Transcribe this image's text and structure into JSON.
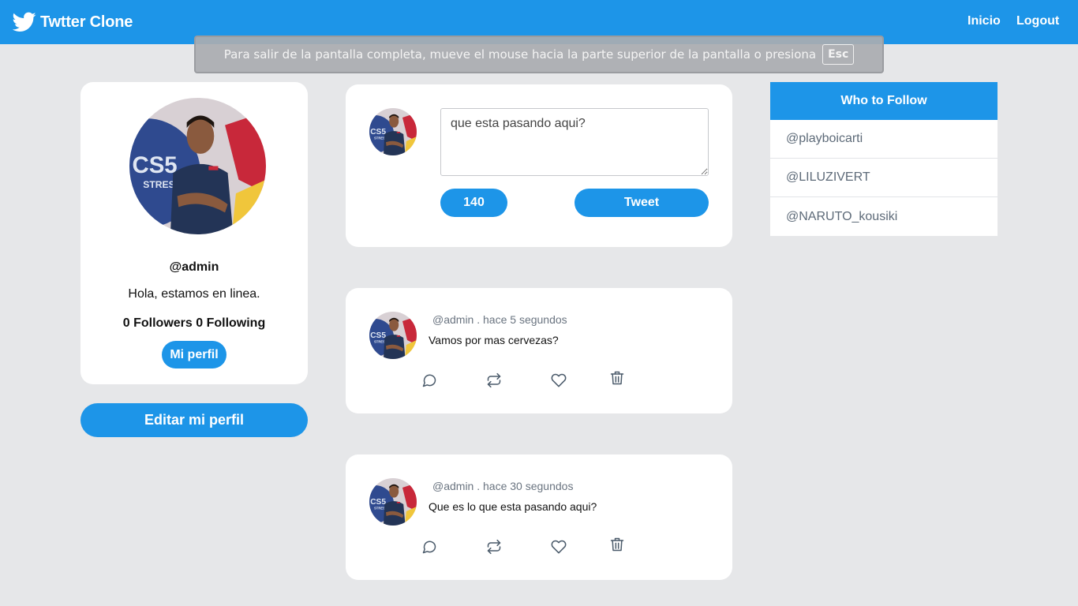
{
  "navbar": {
    "brand": "Twtter Clone",
    "links": {
      "home": "Inicio",
      "logout": "Logout"
    }
  },
  "fullscreen_notice": {
    "message": "Para salir de la pantalla completa, mueve el mouse hacia la parte superior de la pantalla o presiona",
    "key": "Esc"
  },
  "profile": {
    "handle": "@admin",
    "bio": "Hola, estamos en linea.",
    "stats": "0 Followers 0 Following",
    "my_profile_button": "Mi perfil",
    "edit_profile_button": "Editar mi perfil"
  },
  "compose": {
    "placeholder": "que esta pasando aqui?",
    "char_count": "140",
    "tweet_button": "Tweet"
  },
  "tweets": [
    {
      "handle": "@admin",
      "time": ". hace 5 segundos",
      "text": "Vamos por mas cervezas?"
    },
    {
      "handle": "@admin",
      "time": ". hace 30 segundos",
      "text": "Que es lo que esta pasando aqui?"
    }
  ],
  "who_to_follow": {
    "title": "Who to Follow",
    "users": [
      "@playboicarti",
      "@LILUZIVERT",
      "@NARUTO_kousiki"
    ]
  },
  "colors": {
    "primary": "#1d95e8",
    "background": "#e6e7e9",
    "muted_text": "#5d6a78"
  }
}
